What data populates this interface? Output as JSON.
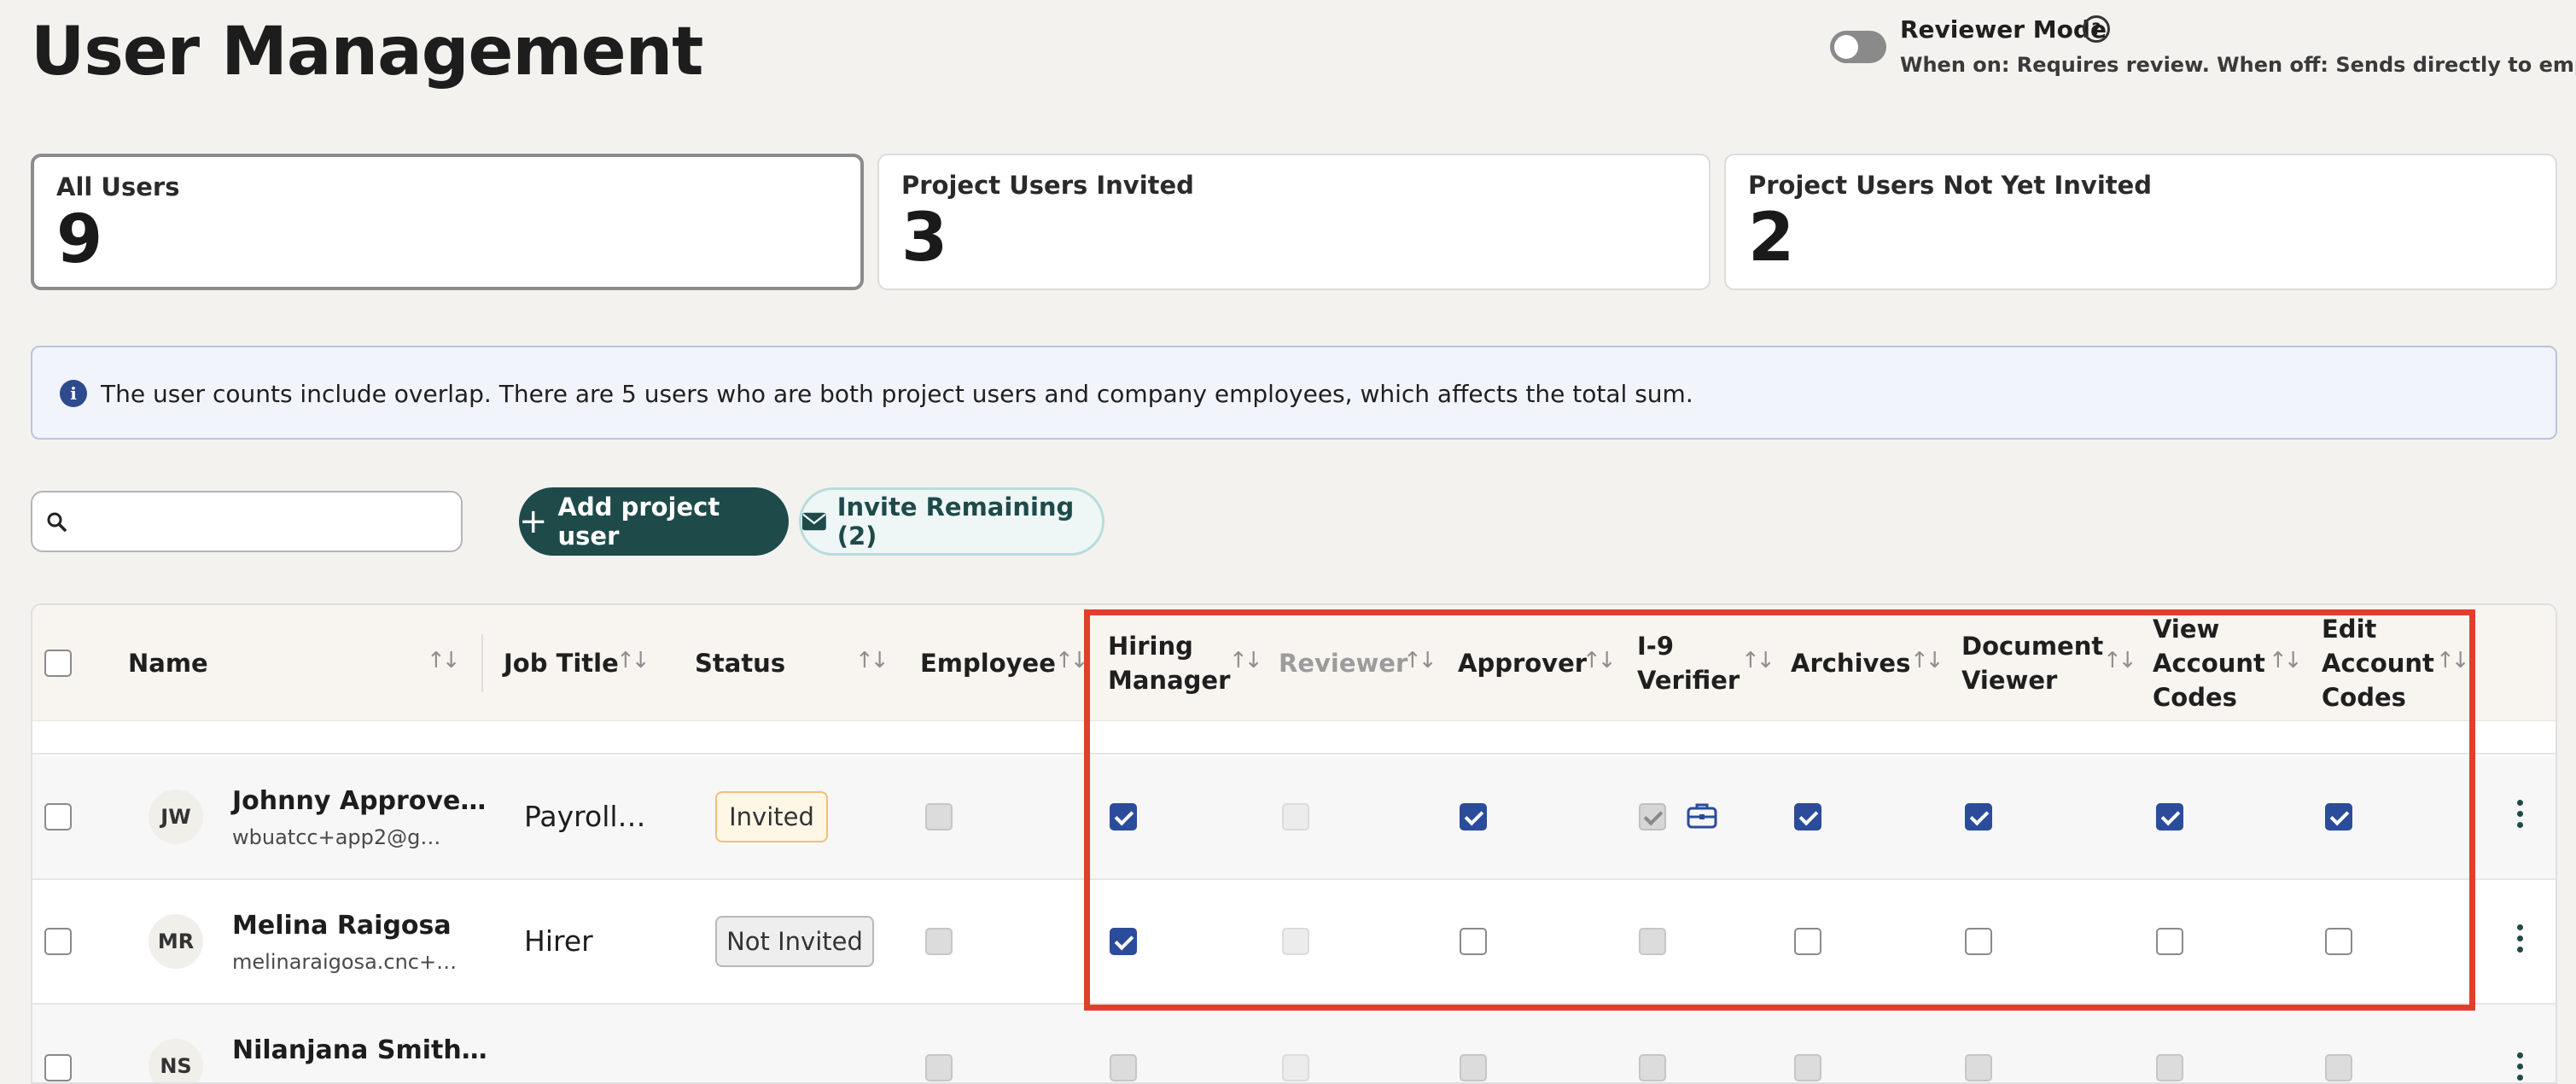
{
  "page_title": "User Management",
  "reviewer_mode": {
    "title": "Reviewer Mode",
    "description": "When on: Requires review. When off: Sends directly to employee.",
    "enabled": false
  },
  "stats": [
    {
      "label": "All Users",
      "value": "9"
    },
    {
      "label": "Project Users Invited",
      "value": "3"
    },
    {
      "label": "Project Users Not Yet Invited",
      "value": "2"
    }
  ],
  "info_banner": "The user counts include overlap. There are 5 users who are both project users and company employees, which affects the total sum.",
  "search": {
    "placeholder": "",
    "value": ""
  },
  "buttons": {
    "add_project_user": "Add project user",
    "invite_remaining": "Invite Remaining (2)"
  },
  "table": {
    "columns": {
      "name": "Name",
      "job_title": "Job Title",
      "status": "Status",
      "employee": "Employee",
      "hiring_manager": "Hiring Manager",
      "reviewer": "Reviewer",
      "approver": "Approver",
      "i9_verifier": "I-9 Verifier",
      "archives": "Archives",
      "document_viewer": "Document Viewer",
      "view_account_codes": "View Account Codes",
      "edit_account_codes": "Edit Account Codes"
    },
    "rows": [
      {
        "initials": "JW",
        "name": "Johnny Approve…",
        "email": "wbuatcc+app2@g…",
        "job_title": "Payroll…",
        "status": "Invited",
        "employee": false,
        "hiring_manager": true,
        "reviewer": false,
        "approver": true,
        "i9_verifier": true,
        "archives": true,
        "document_viewer": true,
        "view_account_codes": true,
        "edit_account_codes": true
      },
      {
        "initials": "MR",
        "name": "Melina Raigosa",
        "email": "melinaraigosa.cnc+…",
        "job_title": "Hirer",
        "status": "Not Invited",
        "employee": false,
        "hiring_manager": true,
        "reviewer": false,
        "approver": false,
        "i9_verifier": false,
        "archives": false,
        "document_viewer": false,
        "view_account_codes": false,
        "edit_account_codes": false
      },
      {
        "initials": "NS",
        "name": "Nilanjana Smith…"
      }
    ]
  },
  "colors": {
    "primary": "#1e4a4a",
    "checkbox_checked": "#2b4c9b",
    "highlight": "#e0402b",
    "invited_badge": "#f1c07a"
  }
}
